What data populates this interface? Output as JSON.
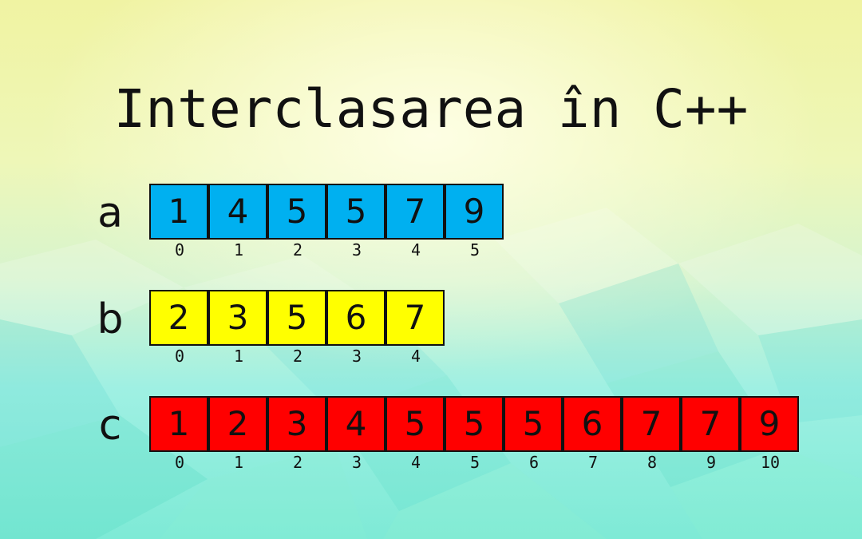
{
  "title": "Interclasarea în C++",
  "colors": {
    "a": "#00b0f0",
    "b": "#ffff00",
    "c": "#ff0000"
  },
  "arrays": [
    {
      "name": "a",
      "values": [
        "1",
        "4",
        "5",
        "5",
        "7",
        "9"
      ],
      "indices": [
        "0",
        "1",
        "2",
        "3",
        "4",
        "5"
      ]
    },
    {
      "name": "b",
      "values": [
        "2",
        "3",
        "5",
        "6",
        "7"
      ],
      "indices": [
        "0",
        "1",
        "2",
        "3",
        "4"
      ]
    },
    {
      "name": "c",
      "values": [
        "1",
        "2",
        "3",
        "4",
        "5",
        "5",
        "5",
        "6",
        "7",
        "7",
        "9"
      ],
      "indices": [
        "0",
        "1",
        "2",
        "3",
        "4",
        "5",
        "6",
        "7",
        "8",
        "9",
        "10"
      ]
    }
  ]
}
